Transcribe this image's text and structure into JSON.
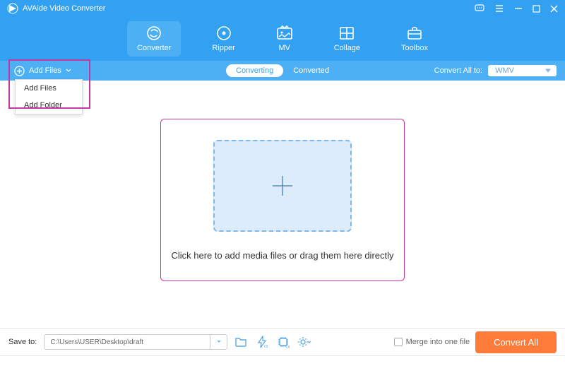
{
  "app": {
    "title": "AVAide Video Converter"
  },
  "nav": {
    "items": [
      {
        "label": "Converter"
      },
      {
        "label": "Ripper"
      },
      {
        "label": "MV"
      },
      {
        "label": "Collage"
      },
      {
        "label": "Toolbox"
      }
    ]
  },
  "subbar": {
    "add_files": "Add Files",
    "tab_converting": "Converting",
    "tab_converted": "Converted",
    "convert_all_label": "Convert All to:",
    "format": "WMV"
  },
  "dropdown": {
    "item1": "Add Files",
    "item2": "Add Folder"
  },
  "dropzone": {
    "instruction": "Click here to add media files or drag them here directly"
  },
  "bottom": {
    "save_to_label": "Save to:",
    "path": "C:\\Users\\USER\\Desktop\\draft",
    "merge_label": "Merge into one file",
    "convert_btn": "Convert All"
  }
}
